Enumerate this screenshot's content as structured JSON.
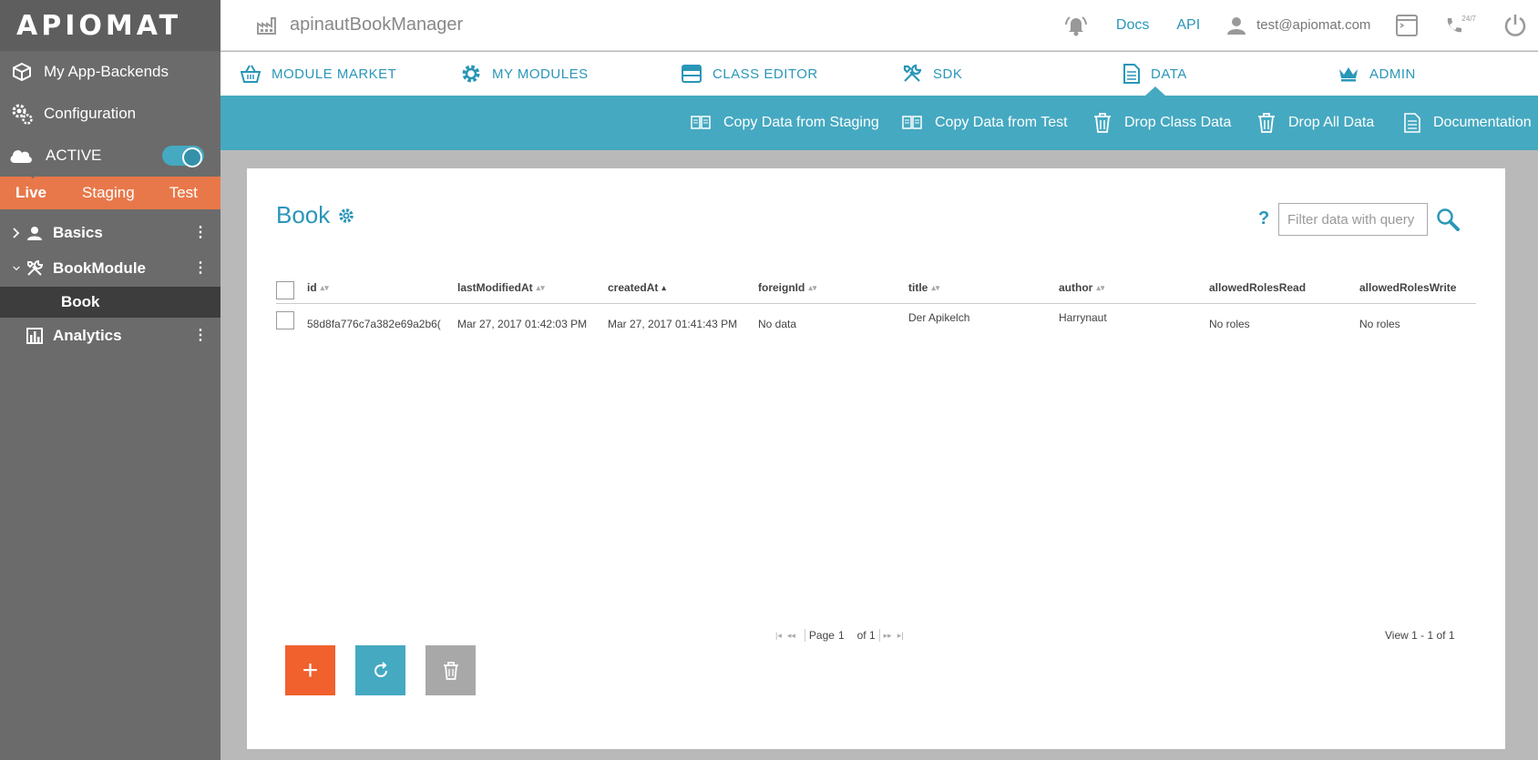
{
  "colors": {
    "accent": "#2a96b8",
    "action_bar": "#45a9c1",
    "env_bar": "#e8784a",
    "sidebar": "#6b6b6b",
    "add_button": "#f0612e"
  },
  "sidebar": {
    "logo": "APIOMAT",
    "items": [
      {
        "label": "My App-Backends",
        "icon": "cube-icon"
      },
      {
        "label": "Configuration",
        "icon": "gears-icon"
      }
    ],
    "status": {
      "label": "ACTIVE",
      "icon": "cloud-icon",
      "enabled": true
    },
    "env_tabs": [
      {
        "label": "Live",
        "active": true
      },
      {
        "label": "Staging",
        "active": false
      },
      {
        "label": "Test",
        "active": false
      }
    ],
    "tree": [
      {
        "label": "Basics",
        "icon": "user-icon",
        "expanded": false
      },
      {
        "label": "BookModule",
        "icon": "tools-icon",
        "expanded": true,
        "children": [
          {
            "label": "Book",
            "selected": true
          }
        ]
      },
      {
        "label": "Analytics",
        "icon": "bar-chart-icon"
      }
    ]
  },
  "topbar": {
    "app_name": "apinautBookManager",
    "docs": "Docs",
    "api": "API",
    "user_email": "test@apiomat.com",
    "support_badge": "24/7"
  },
  "module_nav": [
    {
      "label": "MODULE MARKET",
      "icon": "basket-icon"
    },
    {
      "label": "MY MODULES",
      "icon": "gear-icon"
    },
    {
      "label": "CLASS EDITOR",
      "icon": "window-icon"
    },
    {
      "label": "SDK",
      "icon": "tools-icon"
    },
    {
      "label": "DATA",
      "icon": "document-icon",
      "active": true
    },
    {
      "label": "ADMIN",
      "icon": "crown-icon"
    }
  ],
  "actions": [
    {
      "label": "Copy Data from Staging",
      "icon": "copy-icon"
    },
    {
      "label": "Copy Data from Test",
      "icon": "copy-icon"
    },
    {
      "label": "Drop Class Data",
      "icon": "trash-icon"
    },
    {
      "label": "Drop All Data",
      "icon": "trash-icon"
    },
    {
      "label": "Documentation",
      "icon": "doc-icon"
    }
  ],
  "main": {
    "class_name": "Book",
    "help": "?",
    "filter_placeholder": "Filter data with query",
    "columns": [
      "id",
      "lastModifiedAt",
      "createdAt",
      "foreignId",
      "title",
      "author",
      "allowedRolesRead",
      "allowedRolesWrite"
    ],
    "rows": [
      {
        "id": "58d8fa776c7a382e69a2b6(",
        "lastModifiedAt": "Mar 27, 2017 01:42:03 PM",
        "createdAt": "Mar 27, 2017 01:41:43 PM",
        "foreignId": "No data",
        "title": "Der Apikelch",
        "author": "Harrynaut",
        "allowedRolesRead": "No roles",
        "allowedRolesWrite": "No roles"
      }
    ],
    "pager": {
      "page_label": "Page",
      "page": "1",
      "of_label": "of 1"
    },
    "view_info": "View 1 - 1 of 1",
    "add_label": "+"
  }
}
